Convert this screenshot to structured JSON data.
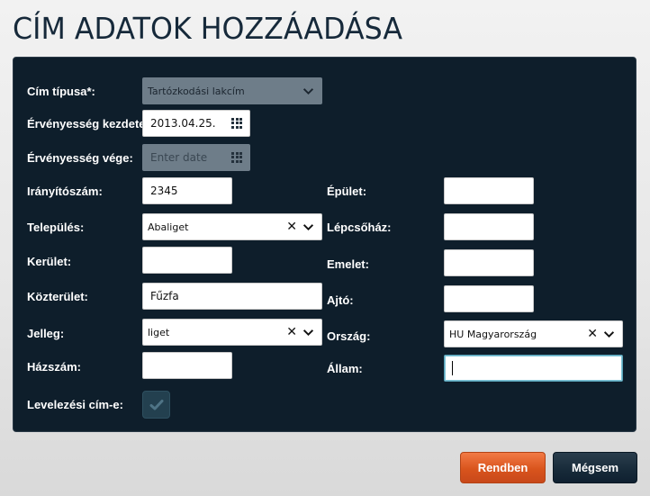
{
  "page": {
    "title": "CÍM ADATOK HOZZÁADÁSA"
  },
  "form": {
    "address_type": {
      "label": "Cím típusa*:",
      "value": "Tartózkodási lakcím"
    },
    "valid_from": {
      "label": "Érvényesség kezdete:",
      "value": "2013.04.25."
    },
    "valid_to": {
      "label": "Érvényesség vége:",
      "placeholder": "Enter date"
    },
    "postal_code": {
      "label": "Irányítószám:",
      "value": "2345"
    },
    "settlement": {
      "label": "Település:",
      "value": "Abaliget"
    },
    "district": {
      "label": "Kerület:",
      "value": ""
    },
    "street": {
      "label": "Közterület:",
      "value": "Fűzfa"
    },
    "street_type": {
      "label": "Jelleg:",
      "value": "liget"
    },
    "house_number": {
      "label": "Házszám:",
      "value": ""
    },
    "mailing_address": {
      "label": "Levelezési cím-e:",
      "checked": true
    },
    "building": {
      "label": "Épület:",
      "value": ""
    },
    "staircase": {
      "label": "Lépcsőház:",
      "value": ""
    },
    "floor": {
      "label": "Emelet:",
      "value": ""
    },
    "door": {
      "label": "Ajtó:",
      "value": ""
    },
    "country": {
      "label": "Ország:",
      "value": "HU Magyarország"
    },
    "state": {
      "label": "Állam:",
      "value": ""
    }
  },
  "buttons": {
    "ok": "Rendben",
    "cancel": "Mégsem"
  },
  "icons": {
    "calendar": "calendar-icon",
    "clear": "clear-icon",
    "dropdown": "chevron-down-icon",
    "check": "check-icon"
  },
  "colors": {
    "panel": "#0e1e2b",
    "title": "#16293a",
    "ok_button": "#d9541d",
    "cancel_button": "#172a39",
    "disabled_field": "#6e7d89"
  }
}
